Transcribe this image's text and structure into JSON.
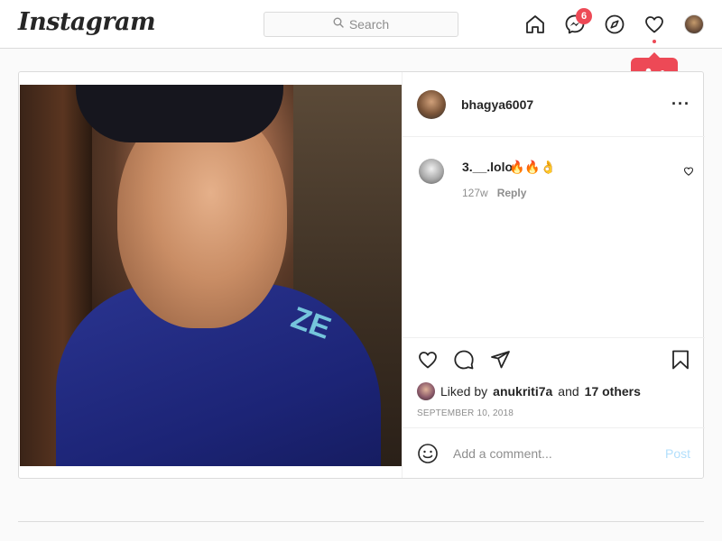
{
  "app": {
    "logo": "Instagram"
  },
  "search": {
    "placeholder": "Search"
  },
  "nav": {
    "messenger_badge": "6",
    "icons": [
      "home-icon",
      "messenger-icon",
      "explore-icon",
      "heart-icon",
      "profile-avatar"
    ]
  },
  "notification": {
    "count": "1",
    "icon": "person-icon"
  },
  "post": {
    "author": "bhagya6007",
    "comments": [
      {
        "user": "3.__.lolo",
        "text": "🔥🔥👌",
        "age": "127w",
        "reply_label": "Reply"
      }
    ],
    "likes": {
      "prefix": "Liked by",
      "user": "anukriti7a",
      "connector": "and",
      "others": "17 others"
    },
    "date": "SEPTEMBER 10, 2018",
    "photo_text": "ZE",
    "add_comment_placeholder": "Add a comment...",
    "post_label": "Post"
  },
  "colors": {
    "accent_red": "#ed4956",
    "post_button_disabled": "#b2dffc",
    "border": "#dbdbdb",
    "secondary_text": "#8e8e8e"
  }
}
